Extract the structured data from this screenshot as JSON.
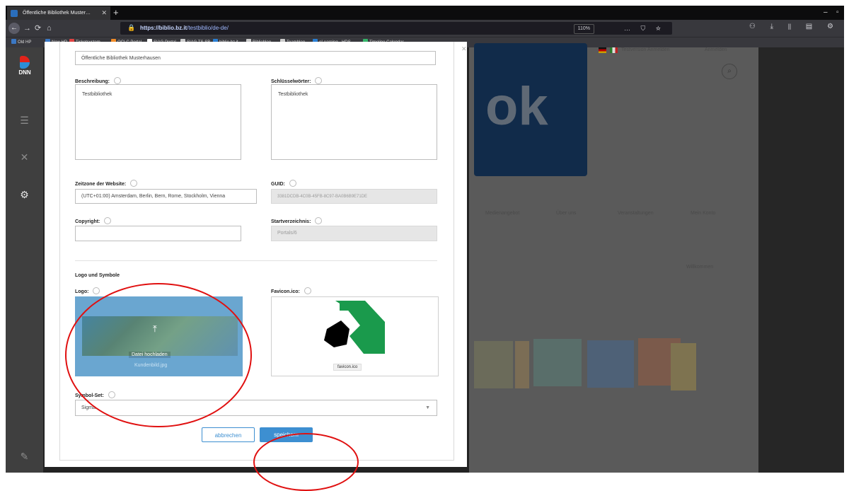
{
  "browser": {
    "tab_title": "Öffentliche Bibliothek Muster…",
    "tab_close": "✕",
    "new_tab": "+",
    "url_host": "https://biblio.bz.it",
    "url_path": "/testbiblio/de-de/",
    "zoom": "110%",
    "url_icons": "… ⛉ ☆",
    "nav": {
      "back": "←",
      "forward": "→",
      "reload": "⟳",
      "home": "⌂"
    },
    "toolbar_icons": "⚇ ⤓ ⫴ ▤ ⚙",
    "window_controls": {
      "minimize": "–",
      "maximize": "▫"
    }
  },
  "bookmarks": [
    {
      "label": "Old HP",
      "color": "#3b78c4"
    },
    {
      "label": "New HP",
      "color": "#3b78c4"
    },
    {
      "label": "Ticketsystem",
      "color": "#e04343"
    },
    {
      "label": "OCLC Portal",
      "color": "#f28c28"
    },
    {
      "label": "SIAG Portal",
      "color": "#ffffff"
    },
    {
      "label": "SIAG TS SB",
      "color": "#cccccc"
    },
    {
      "label": "biblio.bz.it",
      "color": "#2a7fd4"
    },
    {
      "label": "Biblioblog",
      "color": "#cccccc"
    },
    {
      "label": "Teamblog",
      "color": "#cccccc"
    },
    {
      "label": "eLearning - HDS",
      "color": "#2a7fd4"
    },
    {
      "label": "Timeline Calendar",
      "color": "#35b56a"
    }
  ],
  "sidebar": {
    "logo_text": "DNN",
    "icons": [
      "content-icon",
      "tools-icon",
      "settings-icon",
      "edit-icon"
    ]
  },
  "form": {
    "site_name_value": "Öffentliche Bibliothek Musterhausen",
    "beschreibung_label": "Beschreibung:",
    "beschreibung_value": "Testbibliothek",
    "schluesselwoerter_label": "Schlüsselwörter:",
    "schluesselwoerter_value": "Testbibliothek",
    "zeitzone_label": "Zeitzone der Website:",
    "zeitzone_value": "(UTC+01:00) Amsterdam, Berlin, Bern, Rome, Stockholm, Vienna",
    "guid_label": "GUID:",
    "guid_value": "3381DCDB-4C0B-45FB-8C97-BA0B6B9E71DE",
    "copyright_label": "Copyright:",
    "copyright_value": "",
    "startverzeichnis_label": "Startverzeichnis:",
    "startverzeichnis_value": "Portals/6",
    "logo_section_title": "Logo und Symbole",
    "logo_label": "Logo:",
    "logo_upload_text": "Datei hochladen",
    "logo_filename": "Kundenbild.jpg",
    "favicon_label": "Favicon.ico:",
    "favicon_filename": "favicon.ico",
    "symbolset_label": "Symbol-Set:",
    "symbolset_value": "Sigma",
    "cancel_label": "abbrechen",
    "save_label": "speichern"
  },
  "background_site": {
    "language_links": "Testversion Anmelden",
    "login_link": "Anmelden",
    "logo_text": "ok",
    "menu": [
      "Medienangebot",
      "Über uns",
      "Veranstaltungen",
      "Mein Konto"
    ],
    "breadcrumb": "Willkommen"
  },
  "colors": {
    "primary_button": "#3d8fd1",
    "annotation_circle": "#e01010",
    "sidebar_bg": "#3f3f3f"
  }
}
